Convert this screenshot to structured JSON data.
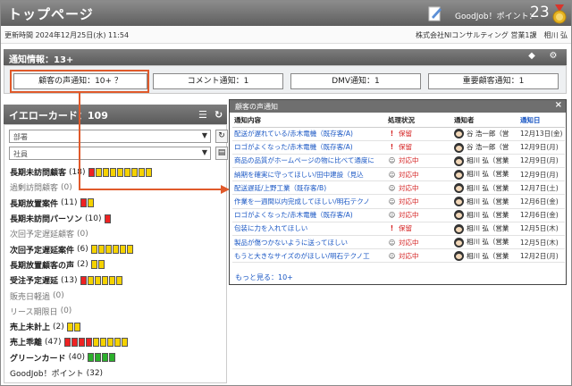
{
  "header": {
    "title": "トップページ",
    "goodjob_label": "GoodJob！ポイント：",
    "goodjob_value": "23"
  },
  "subbar": {
    "updated": "更新時間 2024年12月25日(水) 11:54",
    "company": "株式会社NIコンサルティング 営業1課　相川 弘"
  },
  "notify": {
    "title": "通知情報：13+",
    "tabs": [
      {
        "label": "顧客の声通知：10+ ？"
      },
      {
        "label": "コメント通知：1"
      },
      {
        "label": "DMV通知：1"
      },
      {
        "label": "重要顧客通知：1"
      }
    ]
  },
  "yellow": {
    "title": "イエローカード：109",
    "dept_placeholder": "部署",
    "emp_placeholder": "社員",
    "items": [
      {
        "label": "長期未訪問顧客",
        "count": "(18)",
        "bold": true,
        "bars": "ryyyyyyyy"
      },
      {
        "label": "過剰訪問顧客",
        "count": "(0)",
        "bold": false,
        "bars": ""
      },
      {
        "label": "長期放置案件",
        "count": "(11)",
        "bold": true,
        "bars": "ry"
      },
      {
        "label": "長期未訪問パーソン",
        "count": "(10)",
        "bold": true,
        "bars": "r"
      },
      {
        "label": "次回予定遅延顧客",
        "count": "(0)",
        "bold": false,
        "bars": ""
      },
      {
        "label": "次回予定遅延案件",
        "count": "(6)",
        "bold": true,
        "bars": "yyyyyy"
      },
      {
        "label": "長期放置顧客の声",
        "count": "(2)",
        "bold": true,
        "bars": "yy"
      },
      {
        "label": "受注予定遅延",
        "count": "(13)",
        "bold": true,
        "bars": "ryyyyy"
      },
      {
        "label": "販売日軽過",
        "count": "(0)",
        "bold": false,
        "bars": ""
      },
      {
        "label": "リース期限日",
        "count": "(0)",
        "bold": false,
        "bars": ""
      },
      {
        "label": "売上未計上",
        "count": "(2)",
        "bold": true,
        "bars": "yy"
      },
      {
        "label": "売上乖離",
        "count": "(47)",
        "bold": true,
        "bars": "rrrryyyyy"
      },
      {
        "label": "グリーンカード",
        "count": "(40)",
        "bold": true,
        "bars": "gggg"
      },
      {
        "label": "GoodJob！ポイント",
        "count": "(32)",
        "bold": false,
        "bars": "",
        "plain": true
      }
    ]
  },
  "popup": {
    "title": "顧客の声通知",
    "columns": [
      "通知内容",
      "処理状況",
      "通知者",
      "通知日"
    ],
    "rows": [
      {
        "content": "配送が遅れている/赤木電機（既存客/A)",
        "status": "保留",
        "status_icon": "!",
        "user": "谷 浩一郎（営",
        "date": "12月13日(金)"
      },
      {
        "content": "ロゴがよくなった/赤木電機（既存客/A)",
        "status": "保留",
        "status_icon": "!",
        "user": "谷 浩一郎（営",
        "date": "12月9日(月)"
      },
      {
        "content": "商品の品質がホームページの物に比べて通度に",
        "status": "対応中",
        "status_icon": "☺",
        "user": "相川 弘（営業",
        "date": "12月9日(月)"
      },
      {
        "content": "納期を確実に守ってほしい/田中建設（見込",
        "status": "対応中",
        "status_icon": "☺",
        "user": "相川 弘（営業",
        "date": "12月9日(月)"
      },
      {
        "content": "配送遅延/上野工業（既存客/B)",
        "status": "対応中",
        "status_icon": "☺",
        "user": "相川 弘（営業",
        "date": "12月7日(土)"
      },
      {
        "content": "作業を一週間以内完成してほしい/明石テクノ",
        "status": "対応中",
        "status_icon": "☺",
        "user": "相川 弘（営業",
        "date": "12月6日(金)"
      },
      {
        "content": "ロゴがよくなった/赤木電機（既存客/A)",
        "status": "対応中",
        "status_icon": "☺",
        "user": "相川 弘（営業",
        "date": "12月6日(金)"
      },
      {
        "content": "包装に力を入れてほしい",
        "status": "保留",
        "status_icon": "!",
        "user": "相川 弘（営業",
        "date": "12月5日(木)"
      },
      {
        "content": "製品が傷つかないように送ってほしい",
        "status": "対応中",
        "status_icon": "☺",
        "user": "相川 弘（営業",
        "date": "12月5日(木)"
      },
      {
        "content": "もうと大きなサイズのがほしい/明石テクノ工",
        "status": "対応中",
        "status_icon": "☺",
        "user": "相川 弘（営業",
        "date": "12月2日(月)"
      }
    ],
    "more": "もっと見る：10+"
  },
  "colors": {
    "accent": "#e05a2b",
    "link": "#1a57c4",
    "status": "#d42020"
  }
}
